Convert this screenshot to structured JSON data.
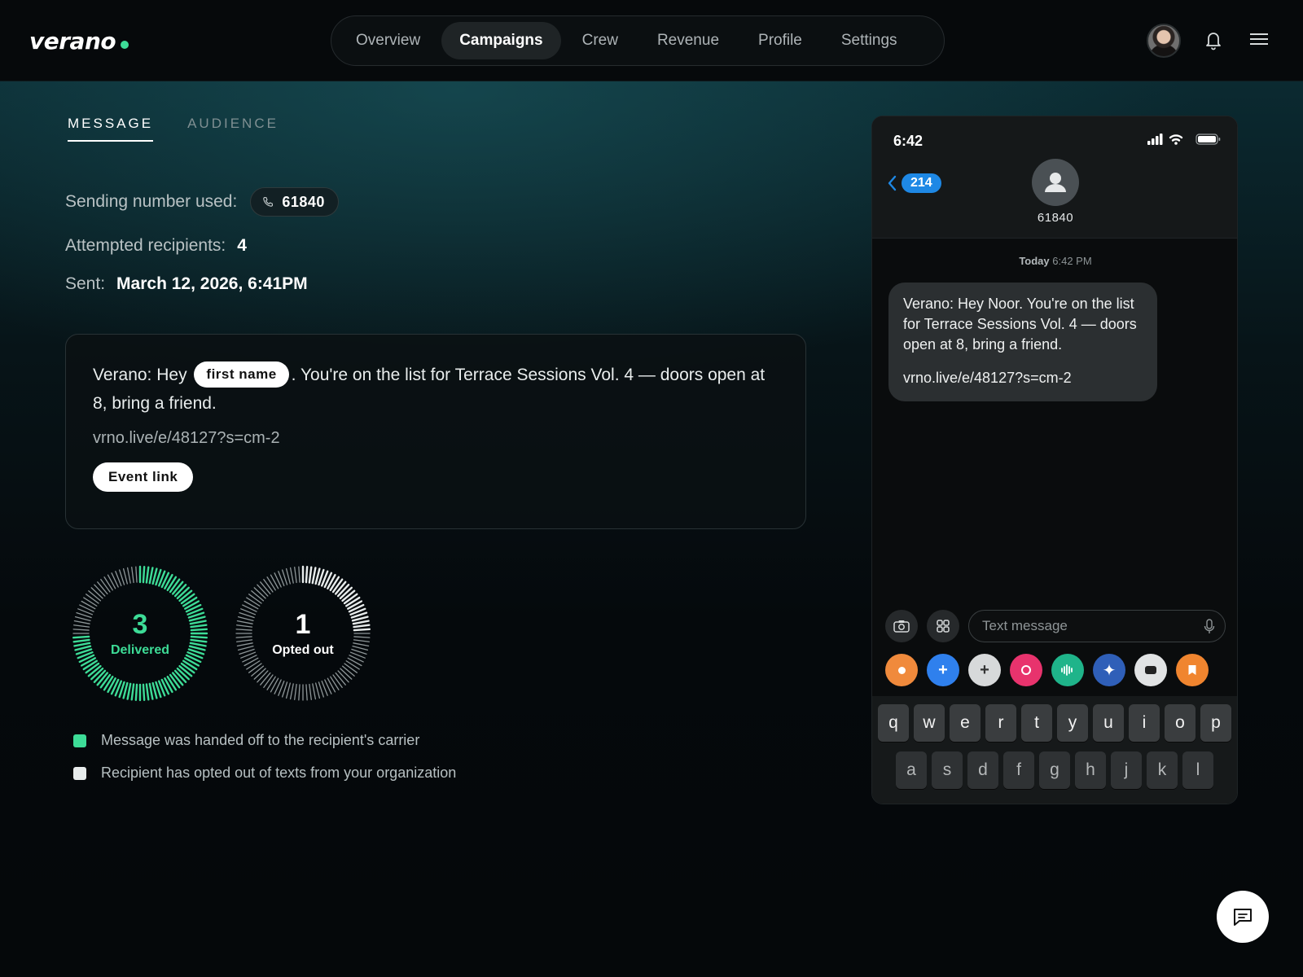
{
  "brand": {
    "name": "verano",
    "accent": "#3ddc97"
  },
  "nav": {
    "items": [
      {
        "label": "Overview",
        "active": false
      },
      {
        "label": "Campaigns",
        "active": true
      },
      {
        "label": "Crew",
        "active": false
      },
      {
        "label": "Revenue",
        "active": false
      },
      {
        "label": "Profile",
        "active": false
      },
      {
        "label": "Settings",
        "active": false
      }
    ],
    "icons": [
      "avatar",
      "bell-icon",
      "menu-icon"
    ]
  },
  "tabs": [
    {
      "label": "MESSAGE",
      "active": true
    },
    {
      "label": "AUDIENCE",
      "active": false
    }
  ],
  "info": {
    "sending_label": "Sending number used:",
    "sending_number": "61840",
    "recipients_label": "Attempted recipients:",
    "recipients_value": "4",
    "sent_label": "Sent:",
    "sent_value": "March 12, 2026, 6:41PM"
  },
  "message": {
    "prefix": "Verano: Hey",
    "merge_field": "first name",
    "suffix": ". You're on the list for Terrace Sessions Vol. 4 — doors open at 8, bring a friend.",
    "link": "vrno.live/e/48127?s=cm-2",
    "link_button": "Event link"
  },
  "stats": {
    "delivered": {
      "value": "3",
      "label": "Delivered",
      "fraction": 0.75,
      "color": "#3ddc97"
    },
    "opted_out": {
      "value": "1",
      "label": "Opted out",
      "fraction": 0.25,
      "color": "#e8ecec"
    }
  },
  "legend": [
    {
      "text": "Message was handed off to the recipient's carrier",
      "color": "#3ddc97"
    },
    {
      "text": "Recipient has opted out of texts from your organization",
      "color": "#e8ecec"
    }
  ],
  "phone": {
    "time": "6:42",
    "back_count": "214",
    "contact": "61840",
    "timestamp_day": "Today",
    "timestamp_time": "6:42 PM",
    "bubble_text": "Verano: Hey Noor. You're on the list for Terrace Sessions Vol. 4 — doors open at 8, bring a friend.",
    "bubble_link": "vrno.live/e/48127?s=cm-2",
    "input_placeholder": "Text message",
    "keys_row1": [
      "q",
      "w",
      "e",
      "r",
      "t",
      "y",
      "u",
      "i",
      "o",
      "p"
    ],
    "keys_row2": [
      "a",
      "s",
      "d",
      "f",
      "g",
      "h",
      "j",
      "k",
      "l"
    ]
  }
}
